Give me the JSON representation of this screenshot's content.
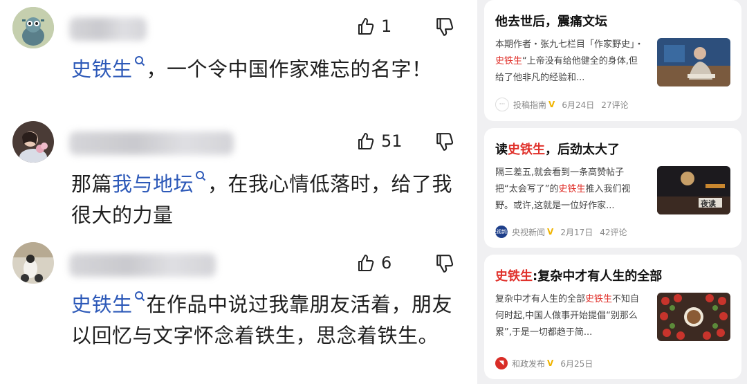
{
  "comments": [
    {
      "likes": "1",
      "text_link": "史铁生",
      "text": "，一个令中国作家难忘的名字！"
    },
    {
      "likes": "51",
      "text_prefix": "那篇",
      "text_link": "我与地坛",
      "text": "，在我心情低落时，给了我很大的力量"
    },
    {
      "likes": "6",
      "text_link": "史铁生",
      "text": "在作品中说过我靠朋友活着，朋友以回忆与文字怀念着铁生，思念着铁生。"
    }
  ],
  "articles": [
    {
      "title": "他去世后，震痛文坛",
      "desc_before": "本期作者・张九七栏目「作家野史」・",
      "desc_highlight": "史铁生",
      "desc_after": "“上帝没有给他健全的身体,但给了他非凡的经验和...",
      "source": "投稿指南",
      "date": "6月24日",
      "comments": "27评论"
    },
    {
      "title_before": "读",
      "title_highlight": "史铁生",
      "title_after": "，后劲太大了",
      "desc_before": "隔三差五,就会看到一条高赞帖子把“太会写了”的",
      "desc_highlight": "史铁生",
      "desc_after": "推入我们视野。或许,这就是一位好作家...",
      "source": "央视新闻",
      "source_badge": "央视新闻",
      "thumb_text": "夜读",
      "date": "2月17日",
      "comments": "42评论"
    },
    {
      "title_highlight": "史铁生",
      "title_after": ":复杂中才有人生的全部",
      "desc_before": "复杂中才有人生的全部",
      "desc_highlight": "史铁生",
      "desc_after": "不知自何时起,中国人做事开始提倡“别那么累”,于是一切都趋于简...",
      "source": "和政发布",
      "date": "6月25日"
    }
  ],
  "colors": {
    "link": "#2d59b8",
    "highlight": "#e0312b",
    "verified": "#f0b400",
    "panel_bg": "#f0f0f2"
  },
  "icons": {
    "like": "thumbs-up-icon",
    "dislike": "thumbs-down-icon",
    "search_hint": "search-hint-icon",
    "verified": "verified-v-icon"
  }
}
